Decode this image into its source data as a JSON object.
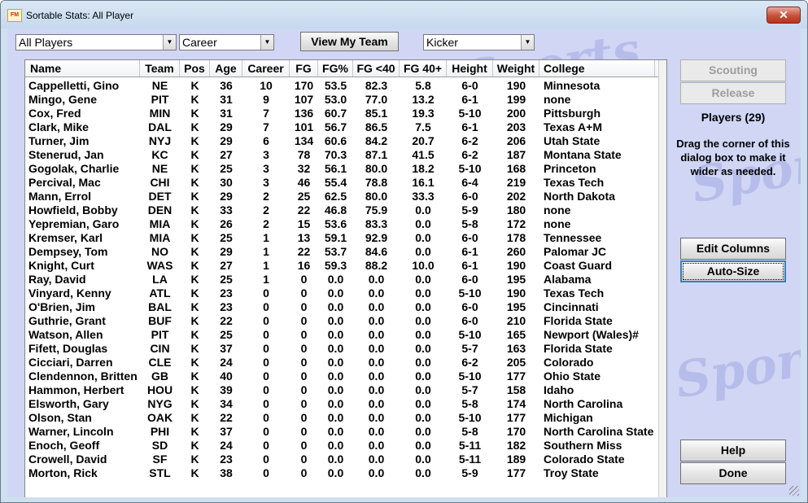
{
  "window": {
    "title": "Sortable Stats: All Player",
    "app_icon": "FM",
    "close_glyph": "✕"
  },
  "watermark": {
    "text": "Sports"
  },
  "toolbar": {
    "players_filter": "All Players",
    "period_filter": "Career",
    "view_my_team_label": "View My Team",
    "position_filter": "Kicker"
  },
  "table": {
    "columns": [
      "Name",
      "Team",
      "Pos",
      "Age",
      "Career",
      "FG",
      "FG%",
      "FG <40",
      "FG 40+",
      "Height",
      "Weight",
      "College"
    ],
    "rows": [
      [
        "Cappelletti, Gino",
        "NE",
        "K",
        "36",
        "10",
        "170",
        "53.5",
        "82.3",
        "5.8",
        "6-0",
        "190",
        "Minnesota"
      ],
      [
        "Mingo, Gene",
        "PIT",
        "K",
        "31",
        "9",
        "107",
        "53.0",
        "77.0",
        "13.2",
        "6-1",
        "199",
        "none"
      ],
      [
        "Cox, Fred",
        "MIN",
        "K",
        "31",
        "7",
        "136",
        "60.7",
        "85.1",
        "19.3",
        "5-10",
        "200",
        "Pittsburgh"
      ],
      [
        "Clark, Mike",
        "DAL",
        "K",
        "29",
        "7",
        "101",
        "56.7",
        "86.5",
        "7.5",
        "6-1",
        "203",
        "Texas A+M"
      ],
      [
        "Turner, Jim",
        "NYJ",
        "K",
        "29",
        "6",
        "134",
        "60.6",
        "84.2",
        "20.7",
        "6-2",
        "206",
        "Utah State"
      ],
      [
        "Stenerud, Jan",
        "KC",
        "K",
        "27",
        "3",
        "78",
        "70.3",
        "87.1",
        "41.5",
        "6-2",
        "187",
        "Montana State"
      ],
      [
        "Gogolak, Charlie",
        "NE",
        "K",
        "25",
        "3",
        "32",
        "56.1",
        "80.0",
        "18.2",
        "5-10",
        "168",
        "Princeton"
      ],
      [
        "Percival, Mac",
        "CHI",
        "K",
        "30",
        "3",
        "46",
        "55.4",
        "78.8",
        "16.1",
        "6-4",
        "219",
        "Texas Tech"
      ],
      [
        "Mann, Errol",
        "DET",
        "K",
        "29",
        "2",
        "25",
        "62.5",
        "80.0",
        "33.3",
        "6-0",
        "202",
        "North Dakota"
      ],
      [
        "Howfield, Bobby",
        "DEN",
        "K",
        "33",
        "2",
        "22",
        "46.8",
        "75.9",
        "0.0",
        "5-9",
        "180",
        "none"
      ],
      [
        "Yepremian, Garo",
        "MIA",
        "K",
        "26",
        "2",
        "15",
        "53.6",
        "83.3",
        "0.0",
        "5-8",
        "172",
        "none"
      ],
      [
        "Kremser, Karl",
        "MIA",
        "K",
        "25",
        "1",
        "13",
        "59.1",
        "92.9",
        "0.0",
        "6-0",
        "178",
        "Tennessee"
      ],
      [
        "Dempsey, Tom",
        "NO",
        "K",
        "29",
        "1",
        "22",
        "53.7",
        "84.6",
        "0.0",
        "6-1",
        "260",
        "Palomar JC"
      ],
      [
        "Knight, Curt",
        "WAS",
        "K",
        "27",
        "1",
        "16",
        "59.3",
        "88.2",
        "10.0",
        "6-1",
        "190",
        "Coast Guard"
      ],
      [
        "Ray, David",
        "LA",
        "K",
        "25",
        "1",
        "0",
        "0.0",
        "0.0",
        "0.0",
        "6-0",
        "195",
        "Alabama"
      ],
      [
        "Vinyard, Kenny",
        "ATL",
        "K",
        "23",
        "0",
        "0",
        "0.0",
        "0.0",
        "0.0",
        "5-10",
        "190",
        "Texas Tech"
      ],
      [
        "O'Brien, Jim",
        "BAL",
        "K",
        "23",
        "0",
        "0",
        "0.0",
        "0.0",
        "0.0",
        "6-0",
        "195",
        "Cincinnati"
      ],
      [
        "Guthrie, Grant",
        "BUF",
        "K",
        "22",
        "0",
        "0",
        "0.0",
        "0.0",
        "0.0",
        "6-0",
        "210",
        "Florida State"
      ],
      [
        "Watson, Allen",
        "PIT",
        "K",
        "25",
        "0",
        "0",
        "0.0",
        "0.0",
        "0.0",
        "5-10",
        "165",
        "Newport (Wales)#"
      ],
      [
        "Fifett, Douglas",
        "CIN",
        "K",
        "37",
        "0",
        "0",
        "0.0",
        "0.0",
        "0.0",
        "5-7",
        "163",
        "Florida State"
      ],
      [
        "Cicciari, Darren",
        "CLE",
        "K",
        "24",
        "0",
        "0",
        "0.0",
        "0.0",
        "0.0",
        "6-2",
        "205",
        "Colorado"
      ],
      [
        "Clendennon, Britten",
        "GB",
        "K",
        "40",
        "0",
        "0",
        "0.0",
        "0.0",
        "0.0",
        "5-10",
        "177",
        "Ohio State"
      ],
      [
        "Hammon, Herbert",
        "HOU",
        "K",
        "39",
        "0",
        "0",
        "0.0",
        "0.0",
        "0.0",
        "5-7",
        "158",
        "Idaho"
      ],
      [
        "Elsworth, Gary",
        "NYG",
        "K",
        "34",
        "0",
        "0",
        "0.0",
        "0.0",
        "0.0",
        "5-8",
        "174",
        "North Carolina"
      ],
      [
        "Olson, Stan",
        "OAK",
        "K",
        "22",
        "0",
        "0",
        "0.0",
        "0.0",
        "0.0",
        "5-10",
        "177",
        "Michigan"
      ],
      [
        "Warner, Lincoln",
        "PHI",
        "K",
        "37",
        "0",
        "0",
        "0.0",
        "0.0",
        "0.0",
        "5-8",
        "170",
        "North Carolina State"
      ],
      [
        "Enoch, Geoff",
        "SD",
        "K",
        "24",
        "0",
        "0",
        "0.0",
        "0.0",
        "0.0",
        "5-11",
        "182",
        "Southern Miss"
      ],
      [
        "Crowell, David",
        "SF",
        "K",
        "23",
        "0",
        "0",
        "0.0",
        "0.0",
        "0.0",
        "5-11",
        "189",
        "Colorado State"
      ],
      [
        "Morton, Rick",
        "STL",
        "K",
        "38",
        "0",
        "0",
        "0.0",
        "0.0",
        "0.0",
        "5-9",
        "177",
        "Troy State"
      ]
    ]
  },
  "side_panel": {
    "scouting_label": "Scouting",
    "release_label": "Release",
    "players_count": "Players (29)",
    "hint": "Drag the corner of this dialog box to make it wider as needed.",
    "edit_columns_label": "Edit Columns",
    "auto_size_label": "Auto-Size",
    "help_label": "Help",
    "done_label": "Done"
  }
}
